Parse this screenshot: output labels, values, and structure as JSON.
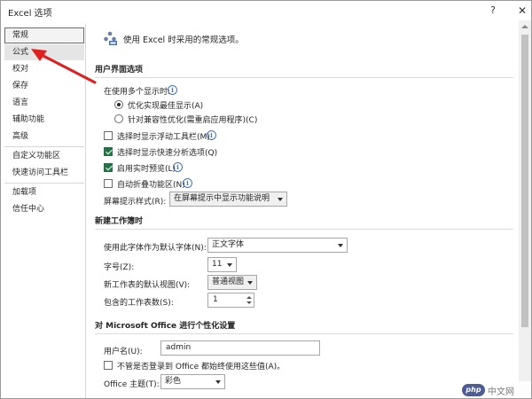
{
  "window": {
    "title": "Excel 选项",
    "help_label": "?",
    "close_label": "✕"
  },
  "sidebar": {
    "items": [
      {
        "label": "常规",
        "state": "selected"
      },
      {
        "label": "公式",
        "state": "hover"
      },
      {
        "label": "校对"
      },
      {
        "label": "保存"
      },
      {
        "label": "语言"
      },
      {
        "label": "辅助功能"
      },
      {
        "label": "高级"
      },
      {
        "label": "自定义功能区"
      },
      {
        "label": "快速访问工具栏"
      },
      {
        "label": "加载项"
      },
      {
        "label": "信任中心"
      }
    ]
  },
  "header": {
    "text": "使用 Excel 时采用的常规选项。"
  },
  "ui_options": {
    "section_title": "用户界面选项",
    "multi_display_label": "在使用多个显示时:",
    "radio_optimize_appearance": "优化实现最佳显示(A)",
    "radio_optimize_compat": "针对兼容性优化(需重启应用程序)(C)",
    "show_mini_toolbar": "选择时显示浮动工具栏(M)",
    "show_quick_analysis": "选择时显示快速分析选项(Q)",
    "enable_live_preview": "启用实时预览(L)",
    "collapse_ribbon": "自动折叠功能区(N)",
    "screentip_label": "屏幕提示样式(R):",
    "screentip_value": "在屏幕提示中显示功能说明",
    "checkbox_states": {
      "show_mini_toolbar": false,
      "show_quick_analysis": true,
      "enable_live_preview": true,
      "collapse_ribbon": false
    }
  },
  "new_workbook": {
    "section_title": "新建工作簿时",
    "font_label": "使用此字体作为默认字体(N):",
    "font_value": "正文字体",
    "size_label": "字号(Z):",
    "size_value": "11",
    "view_label": "新工作表的默认视图(V):",
    "view_value": "普通视图",
    "sheets_label": "包含的工作表数(S):",
    "sheets_value": "1"
  },
  "personalize": {
    "section_title": "对 Microsoft Office 进行个性化设置",
    "username_label": "用户名(U):",
    "username_value": "admin",
    "always_use_label": "不管是否登录到 Office 都始终使用这些值(A)。",
    "theme_label": "Office 主题(T):",
    "theme_value": "彩色",
    "always_use_checked": false
  },
  "watermark": {
    "logo_text": "php",
    "site_text": "中文网"
  },
  "colors": {
    "accent_green": "#217346",
    "info_blue": "#4472c4",
    "annotation_red": "#e02020"
  }
}
